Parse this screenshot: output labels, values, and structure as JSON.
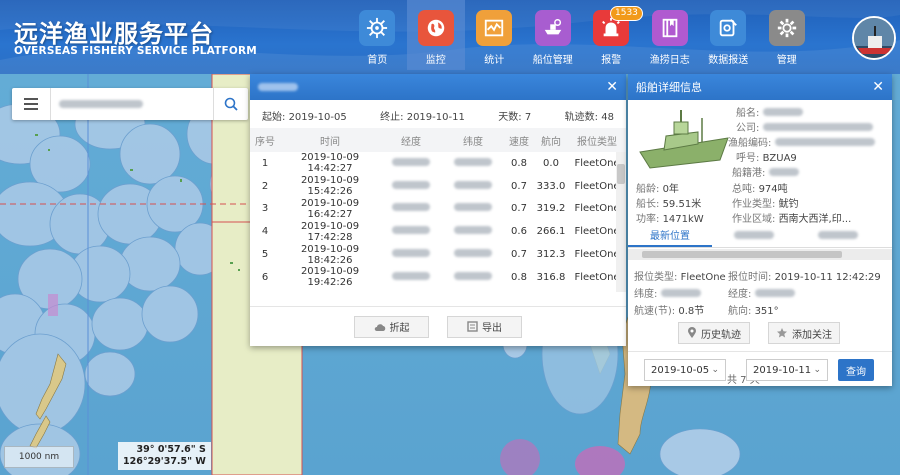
{
  "header": {
    "title_cn": "远洋渔业服务平台",
    "title_en": "OVERSEAS FISHERY SERVICE PLATFORM",
    "nav": [
      {
        "label": "首页",
        "icon": "helm-icon",
        "color": "#3e8ad8"
      },
      {
        "label": "监控",
        "icon": "globe-icon",
        "color": "#e8553c"
      },
      {
        "label": "统计",
        "icon": "chart-icon",
        "color": "#f0a03a"
      },
      {
        "label": "船位管理",
        "icon": "ship-position-icon",
        "color": "#a85dd0"
      },
      {
        "label": "报警",
        "icon": "alarm-icon",
        "color": "#e83a3a",
        "badge": "1533"
      },
      {
        "label": "渔捞日志",
        "icon": "logbook-icon",
        "color": "#b05ad0"
      },
      {
        "label": "数据报送",
        "icon": "report-icon",
        "color": "#3e8ad8"
      },
      {
        "label": "管理",
        "icon": "gear-icon",
        "color": "#8a8a8a"
      }
    ]
  },
  "track_panel": {
    "start_label": "起始:",
    "start": "2019-10-05",
    "end_label": "终止:",
    "end": "2019-10-11",
    "days_label": "天数:",
    "days": "7",
    "points_label": "轨迹数:",
    "points": "48",
    "columns": [
      "序号",
      "时间",
      "经度",
      "纬度",
      "速度",
      "航向",
      "报位类型"
    ],
    "rows": [
      {
        "no": "1",
        "time": "2019-10-09 14:42:27",
        "speed": "0.8",
        "course": "0.0",
        "type": "FleetOne"
      },
      {
        "no": "2",
        "time": "2019-10-09 15:42:26",
        "speed": "0.7",
        "course": "333.0",
        "type": "FleetOne"
      },
      {
        "no": "3",
        "time": "2019-10-09 16:42:27",
        "speed": "0.7",
        "course": "319.2",
        "type": "FleetOne"
      },
      {
        "no": "4",
        "time": "2019-10-09 17:42:28",
        "speed": "0.6",
        "course": "266.1",
        "type": "FleetOne"
      },
      {
        "no": "5",
        "time": "2019-10-09 18:42:26",
        "speed": "0.7",
        "course": "312.3",
        "type": "FleetOne"
      },
      {
        "no": "6",
        "time": "2019-10-09 19:42:26",
        "speed": "0.8",
        "course": "316.8",
        "type": "FleetOne"
      }
    ],
    "collapse_label": "折起",
    "export_label": "导出"
  },
  "detail_panel": {
    "title": "船舶详细信息",
    "ship_name_label": "船名:",
    "company_label": "公司:",
    "fishery_code_label": "渔船编码:",
    "callsign_label": "呼号:",
    "callsign": "BZUA9",
    "port_label": "船籍港:",
    "age_label": "船龄:",
    "age": "0年",
    "tonnage_label": "总吨:",
    "tonnage": "974吨",
    "length_label": "船长:",
    "length": "59.51米",
    "work_type_label": "作业类型:",
    "work_type": "鱿钓",
    "power_label": "功率:",
    "power": "1471kW",
    "area_label": "作业区域:",
    "area": "西南大西洋,印...",
    "tab_label": "最新位置",
    "report_type_label": "报位类型:",
    "report_type": "FleetOne",
    "report_time_label": "报位时间:",
    "report_time": "2019-10-11 12:42:29",
    "lat_label": "纬度:",
    "lon_label": "经度:",
    "speed_label": "航速(节):",
    "speed": "0.8节",
    "course_label": "航向:",
    "course": "351°",
    "history_label": "历史轨迹",
    "follow_label": "添加关注",
    "date_from": "2019-10-05",
    "date_to": "2019-10-11",
    "days_text": "共 7 天",
    "query_label": "查询"
  },
  "map": {
    "scale": "1000 nm",
    "coord_lat": "39° 0'57.6\" S",
    "coord_lon": "126°29'37.5\" W"
  }
}
